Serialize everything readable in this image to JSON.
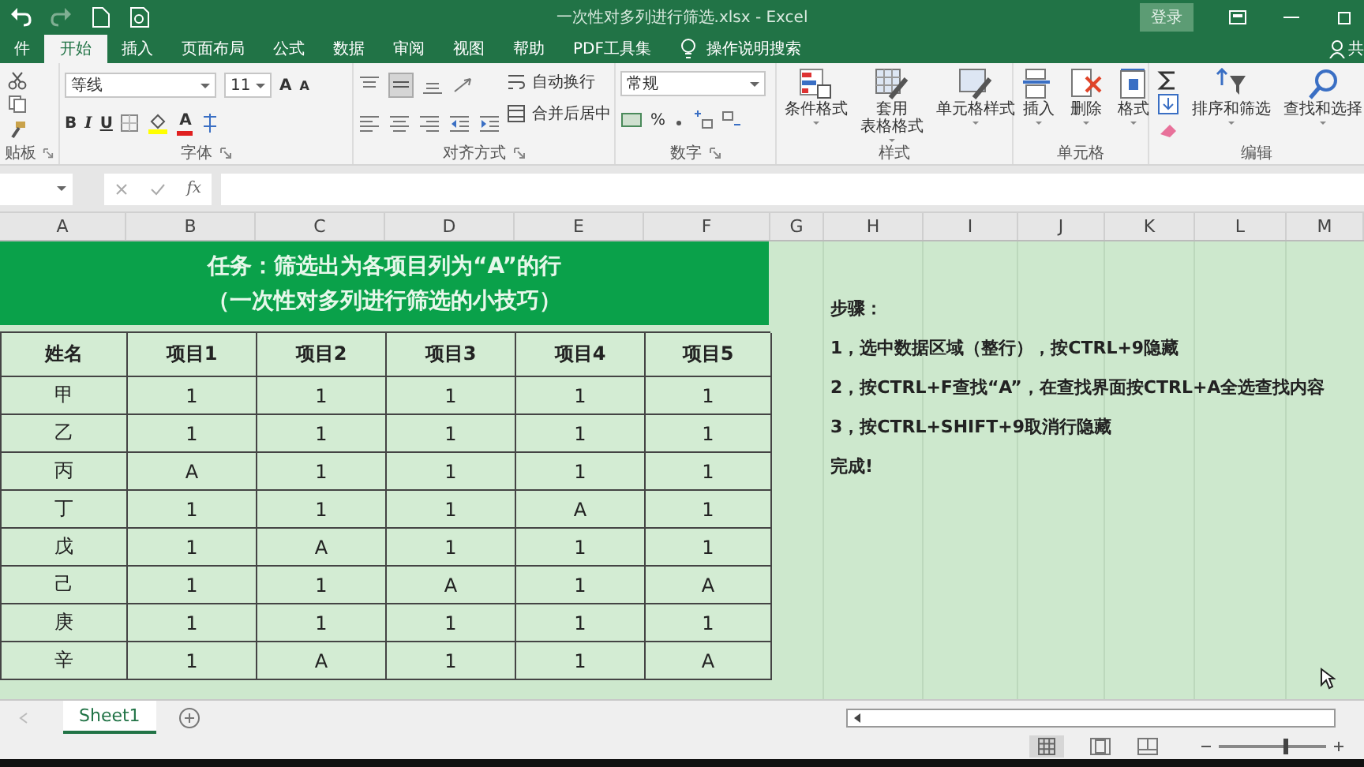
{
  "title_bar": {
    "title": "一次性对多列进行筛选.xlsx  -  Excel",
    "login_button": "登录"
  },
  "tabs": [
    {
      "label": "件",
      "selected": false
    },
    {
      "label": "开始",
      "selected": true
    },
    {
      "label": "插入",
      "selected": false
    },
    {
      "label": "页面布局",
      "selected": false
    },
    {
      "label": "公式",
      "selected": false
    },
    {
      "label": "数据",
      "selected": false
    },
    {
      "label": "审阅",
      "selected": false
    },
    {
      "label": "视图",
      "selected": false
    },
    {
      "label": "帮助",
      "selected": false
    },
    {
      "label": "PDF工具集",
      "selected": false
    }
  ],
  "search_hint": "操作说明搜索",
  "share_label": "共",
  "ribbon": {
    "groups": [
      {
        "kind": "clipboard",
        "label": "贴板"
      },
      {
        "kind": "font",
        "label": "字体",
        "font_name": "等线",
        "font_size": "11",
        "size_buttons": [
          "A",
          "A"
        ],
        "style_buttons": [
          "B",
          "I",
          "U"
        ],
        "color_button": "A"
      },
      {
        "kind": "alignment",
        "label": "对齐方式",
        "commands": [
          "自动换行",
          "合并后居中"
        ]
      },
      {
        "kind": "number",
        "label": "数字",
        "format": "常规",
        "percent": "%"
      },
      {
        "kind": "styles",
        "label": "样式",
        "commands": [
          {
            "lines": [
              "条件格式"
            ]
          },
          {
            "lines": [
              "套用",
              "表格格式"
            ]
          },
          {
            "lines": [
              "单元格样式"
            ]
          }
        ]
      },
      {
        "kind": "cells",
        "label": "单元格",
        "commands": [
          {
            "lines": [
              "插入"
            ]
          },
          {
            "lines": [
              "删除"
            ]
          },
          {
            "lines": [
              "格式"
            ]
          }
        ]
      },
      {
        "kind": "editing",
        "label": "编辑",
        "commands": [
          {
            "lines": [
              "排序和筛选"
            ]
          },
          {
            "lines": [
              "查找和选择"
            ]
          }
        ]
      }
    ]
  },
  "formula_bar": {
    "function_label": "fx"
  },
  "sheet": {
    "columns": [
      "A",
      "B",
      "C",
      "D",
      "E",
      "F",
      "G",
      "H",
      "I",
      "J",
      "K",
      "L",
      "M"
    ],
    "banner": [
      "任务：筛选出为各项目列为“A”的行",
      "（一次性对多列进行筛选的小技巧）"
    ],
    "table": {
      "headers": [
        "姓名",
        "项目1",
        "项目2",
        "项目3",
        "项目4",
        "项目5"
      ],
      "rows": [
        [
          "甲",
          "1",
          "1",
          "1",
          "1",
          "1"
        ],
        [
          "乙",
          "1",
          "1",
          "1",
          "1",
          "1"
        ],
        [
          "丙",
          "A",
          "1",
          "1",
          "1",
          "1"
        ],
        [
          "丁",
          "1",
          "1",
          "1",
          "A",
          "1"
        ],
        [
          "戊",
          "1",
          "A",
          "1",
          "1",
          "1"
        ],
        [
          "己",
          "1",
          "1",
          "A",
          "1",
          "A"
        ],
        [
          "庚",
          "1",
          "1",
          "1",
          "1",
          "1"
        ],
        [
          "辛",
          "1",
          "A",
          "1",
          "1",
          "A"
        ]
      ]
    },
    "steps": [
      "步骤：",
      "1，选中数据区域（整行），按CTRL+9隐藏",
      "2，按CTRL+F查找“A”，在查找界面按CTRL+A全选查找内容",
      "3，按CTRL+SHIFT+9取消行隐藏",
      "完成!"
    ]
  },
  "sheet_tabs": [
    {
      "label": "Sheet1",
      "selected": true
    }
  ],
  "status_bar": {
    "zoom": {
      "level": 0.62
    }
  }
}
